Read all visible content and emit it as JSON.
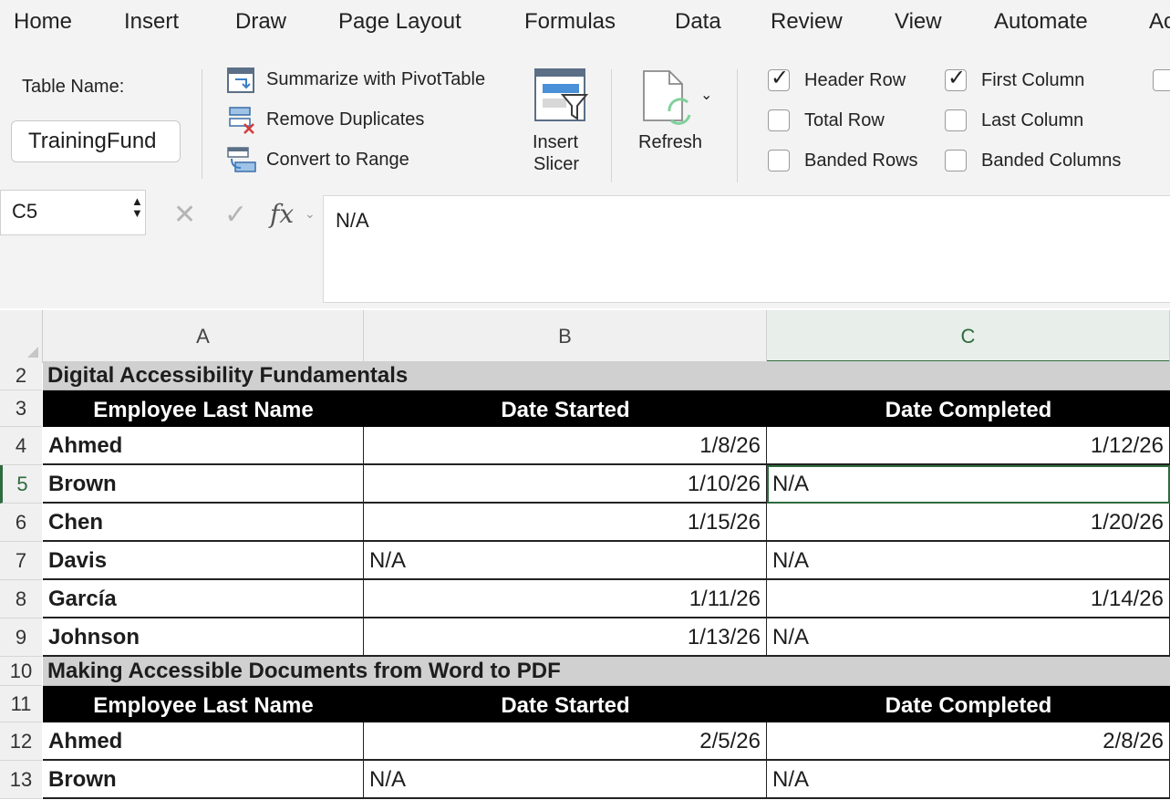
{
  "ribbon_tabs": [
    "Home",
    "Insert",
    "Draw",
    "Page Layout",
    "Formulas",
    "Data",
    "Review",
    "View",
    "Automate",
    "Ac"
  ],
  "table_design": {
    "table_name_label": "Table Name:",
    "table_name_value": "TrainingFund",
    "tools": {
      "summarize": "Summarize with PivotTable",
      "remove_duplicates": "Remove Duplicates",
      "convert_to_range": "Convert to Range"
    },
    "insert_slicer": [
      "Insert",
      "Slicer"
    ],
    "refresh": "Refresh",
    "style_options": [
      {
        "label": "Header Row",
        "checked": true
      },
      {
        "label": "Total Row",
        "checked": false
      },
      {
        "label": "Banded Rows",
        "checked": false
      },
      {
        "label": "First Column",
        "checked": true
      },
      {
        "label": "Last Column",
        "checked": false
      },
      {
        "label": "Banded Columns",
        "checked": false
      }
    ]
  },
  "formula_bar": {
    "cell_ref": "C5",
    "fx": "fx",
    "formula": "N/A"
  },
  "columns": [
    "A",
    "B",
    "C"
  ],
  "rows": [
    {
      "num": "2",
      "type": "section",
      "a": "Digital Accessibility Fundamentals"
    },
    {
      "num": "3",
      "type": "header",
      "a": "Employee Last Name",
      "b": "Date Started",
      "c": "Date Completed"
    },
    {
      "num": "4",
      "type": "data",
      "a": "Ahmed",
      "b": "1/8/26",
      "c": "1/12/26"
    },
    {
      "num": "5",
      "type": "data",
      "a": "Brown",
      "b": "1/10/26",
      "c": "N/A"
    },
    {
      "num": "6",
      "type": "data",
      "a": "Chen",
      "b": "1/15/26",
      "c": "1/20/26"
    },
    {
      "num": "7",
      "type": "data",
      "a": "Davis",
      "b": "N/A",
      "c": "N/A"
    },
    {
      "num": "8",
      "type": "data",
      "a": "García",
      "b": "1/11/26",
      "c": "1/14/26"
    },
    {
      "num": "9",
      "type": "data",
      "a": "Johnson",
      "b": "1/13/26",
      "c": "N/A"
    },
    {
      "num": "10",
      "type": "section",
      "a": "Making Accessible Documents from Word to PDF"
    },
    {
      "num": "11",
      "type": "header",
      "a": "Employee Last Name",
      "b": "Date Started",
      "c": "Date Completed"
    },
    {
      "num": "12",
      "type": "data",
      "a": "Ahmed",
      "b": "2/5/26",
      "c": "2/8/26"
    },
    {
      "num": "13",
      "type": "data",
      "a": "Brown",
      "b": "N/A",
      "c": "N/A"
    }
  ],
  "selected_cell": "C5",
  "colors": {
    "accent_green": "#2e6b3e",
    "header_black": "#000000",
    "section_gray": "#d0d0d0"
  }
}
